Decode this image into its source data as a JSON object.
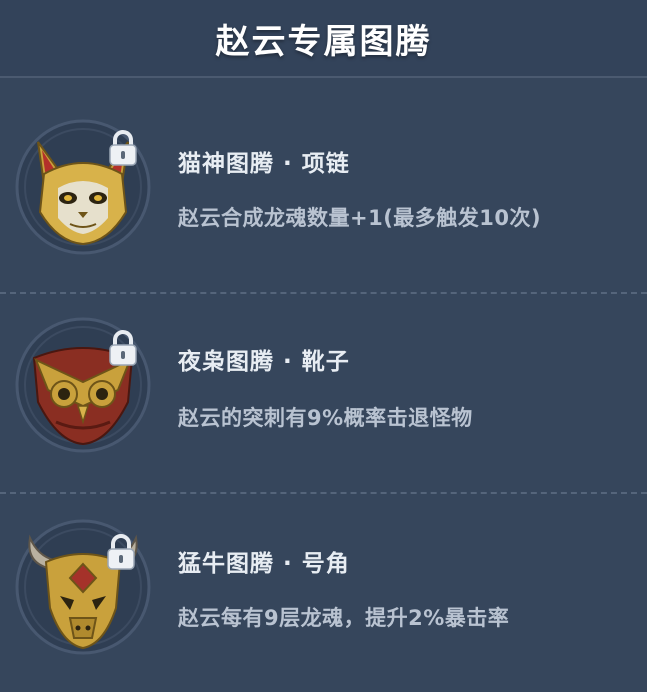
{
  "header": {
    "title": "赵云专属图腾"
  },
  "totems": [
    {
      "name": "猫神图腾 · 项链",
      "desc": "赵云合成龙魂数量+1(最多触发10次)",
      "icon": "cat-mask-icon"
    },
    {
      "name": "夜枭图腾 · 靴子",
      "desc": "赵云的突刺有9%概率击退怪物",
      "icon": "owl-mask-icon"
    },
    {
      "name": "猛牛图腾 · 号角",
      "desc": "赵云每有9层龙魂，提升2%暴击率",
      "icon": "bull-skull-icon"
    }
  ],
  "colors": {
    "background": "#36465c",
    "gold": "#c9a13c",
    "text_primary": "#e8edf3",
    "text_secondary": "#b9c3d1"
  }
}
